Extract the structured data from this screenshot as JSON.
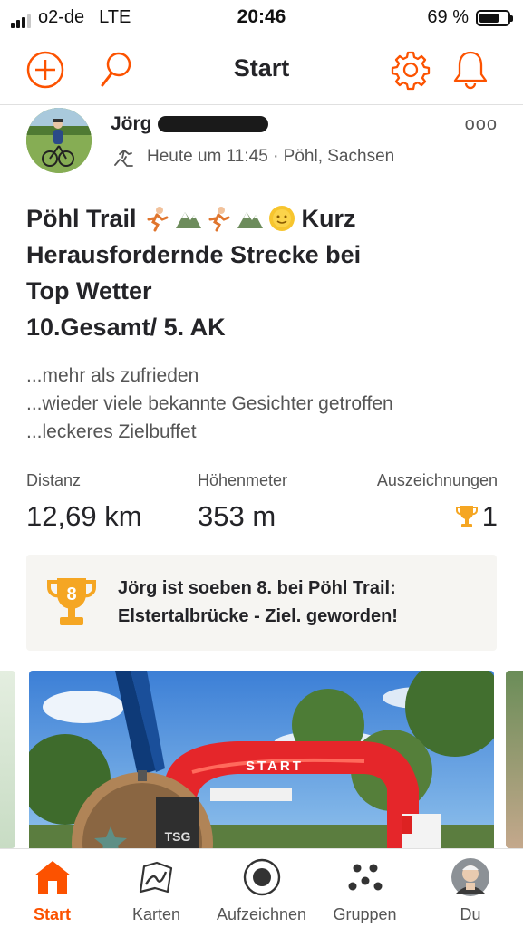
{
  "status_bar": {
    "carrier": "o2-de",
    "network": "LTE",
    "time": "20:46",
    "battery": "69 %",
    "battery_level": 0.69
  },
  "header": {
    "title": "Start",
    "icons": [
      "add-icon",
      "search-icon",
      "settings-icon",
      "notifications-icon"
    ]
  },
  "post": {
    "author": "Jörg",
    "more_label": "ooo",
    "activity_icon": "run-icon",
    "meta": "Heute um 11:45 · Pöhl, Sachsen",
    "title_lines": [
      "Pöhl Trail",
      "Kurz",
      "Herausfordernde Strecke bei",
      "Top Wetter",
      "10.Gesamt/ 5. AK"
    ],
    "title_emojis": [
      "🏃",
      "⛰️",
      "🏃",
      "⛰️",
      "🌞"
    ],
    "description": [
      "...mehr als zufrieden",
      "...wieder viele bekannte Gesichter getroffen",
      "...leckeres Zielbuffet"
    ],
    "stats": {
      "distance_label": "Distanz",
      "distance_value": "12,69 km",
      "elevation_label": "Höhenmeter",
      "elevation_value": "353 m",
      "awards_label": "Auszeichnungen",
      "awards_value": "1"
    },
    "achievement": {
      "rank": "8",
      "line1": "Jörg ist soeben 8. bei Pöhl Trail:",
      "line2": "Elstertalbrücke - Ziel. geworden!"
    },
    "photo": {
      "banner_text": "START",
      "medal_text": "TSG"
    }
  },
  "tabbar": {
    "tabs": [
      {
        "label": "Start",
        "icon": "home-icon",
        "active": true
      },
      {
        "label": "Karten",
        "icon": "map-icon",
        "active": false
      },
      {
        "label": "Aufzeichnen",
        "icon": "record-icon",
        "active": false
      },
      {
        "label": "Gruppen",
        "icon": "groups-icon",
        "active": false
      },
      {
        "label": "Du",
        "icon": "profile-avatar",
        "active": false
      }
    ]
  },
  "colors": {
    "accent": "#fc5200",
    "trophy": "#f5a623",
    "text": "#242428",
    "muted": "#555555"
  }
}
